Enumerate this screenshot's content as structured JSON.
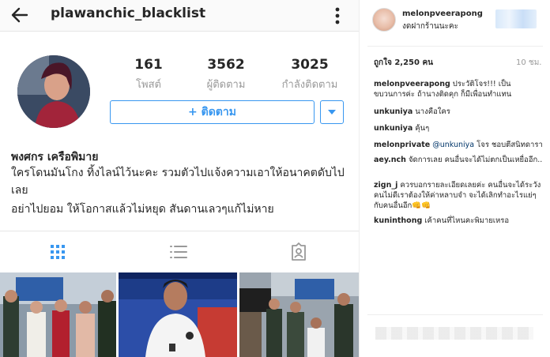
{
  "left": {
    "username": "plawanchic_blacklist",
    "stats": [
      {
        "value": "161",
        "label": "โพสต์"
      },
      {
        "value": "3562",
        "label": "ผู้ติดตาม"
      },
      {
        "value": "3025",
        "label": "กำลังติดตาม"
      }
    ],
    "follow_label": "+ ติดตาม",
    "full_name": "พงศกร เครือพิมาย",
    "bio_lines": [
      "ใครโดนมันโกง ทิ้งไลน์ไว้นะคะ รวมตัวไปแจ้งความเอาให้อนาคตดับไป",
      "เลย",
      "อย่าไปยอม ให้โอกาสแล้วไม่หยุด สันดานเลวๆแก้ไม่หาย"
    ],
    "icons": {
      "back": "back-arrow-icon",
      "menu": "more-vertical-icon",
      "grid": "grid-icon",
      "list": "list-icon",
      "tagged": "tagged-person-icon",
      "dropdown": "chevron-down-icon"
    },
    "colors": {
      "accent": "#3897f0",
      "muted": "#999999"
    }
  },
  "right": {
    "username": "melonpveerapong",
    "location": "งดฝากร้านนะคะ",
    "likes": "ถูกใจ 2,250 คน",
    "time": "10 ชม.",
    "comments": [
      {
        "user": "melonpveerapong",
        "mention": "",
        "text": "ประวัติโจร!!! เป็นขบวนการค่ะ ถ้านางติดคุก ก็มีเพื่อนทำแทน"
      },
      {
        "user": "unkuniya",
        "mention": "",
        "text": "นางคือใคร"
      },
      {
        "user": "unkuniya",
        "mention": "",
        "text": "คุ้นๆ"
      },
      {
        "user": "melonprivate",
        "mention": "@unkuniya",
        "text": "โจร ชอบตีสนิทดารา"
      },
      {
        "user": "aey.nch",
        "mention": "",
        "text": "จัดการเลย คนอื่นจะได้ไม่ตกเป็นเหยื่ออีก.."
      },
      {
        "user": "zign_j",
        "mention": "",
        "text": "ควรบอกรายละเอียดเลยค่ะ คนอื่นจะได้ระวัง คนไม่ดีเราต้องให้ค่าหลาบจำ จะได้เลิกทำอะไรแย่ๆกับคนอื่นอีก👊👊"
      },
      {
        "user": "kuninthong",
        "mention": "",
        "text": "เค้าคนที่ไหนคะพิมายเหรอ"
      }
    ]
  }
}
